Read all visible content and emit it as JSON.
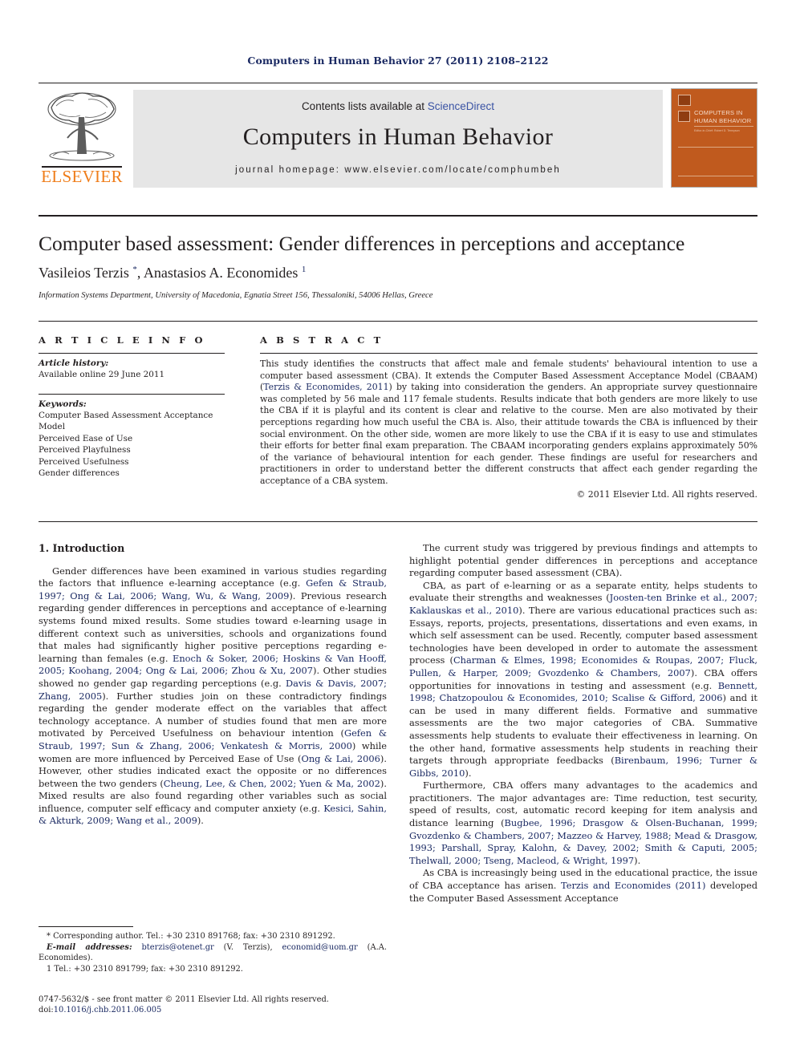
{
  "running_head": "Computers in Human Behavior 27 (2011) 2108–2122",
  "masthead": {
    "contents_prefix": "Contents lists available at ",
    "sciencedirect": "ScienceDirect",
    "journal_title": "Computers in Human Behavior",
    "homepage": "journal homepage: www.elsevier.com/locate/comphumbeh",
    "publisher_wordmark": "ELSEVIER",
    "cover": {
      "title": "COMPUTERS IN HUMAN BEHAVIOR",
      "subtitle": "Editor-in-Chief: Robert D. Tennyson",
      "accent": "#c05a1e"
    }
  },
  "article": {
    "title": "Computer based assessment: Gender differences in perceptions and acceptance",
    "authors_part1": "Vasileios Terzis ",
    "authors_star": "*",
    "authors_part2": ", Anastasios A. Economides ",
    "authors_sup": "1",
    "affiliation": "Information Systems Department, University of Macedonia, Egnatia Street 156, Thessaloniki, 54006 Hellas, Greece"
  },
  "info": {
    "heading": "A R T I C L E   I N F O",
    "history_label": "Article history:",
    "history_value": "Available online 29 June 2011",
    "keywords_label": "Keywords:",
    "keywords": [
      "Computer Based Assessment Acceptance",
      "Model",
      "Perceived Ease of Use",
      "Perceived Playfulness",
      "Perceived Usefulness",
      "Gender differences"
    ]
  },
  "abstract": {
    "heading": "A B S T R A C T",
    "text_before_ref": "This study identifies the constructs that affect male and female students' behavioural intention to use a computer based assessment (CBA). It extends the Computer Based Assessment Acceptance Model (CBAAM) (",
    "ref": "Terzis & Economides, 2011",
    "text_after_ref": ") by taking into consideration the genders. An appropriate survey questionnaire was completed by 56 male and 117 female students. Results indicate that both genders are more likely to use the CBA if it is playful and its content is clear and relative to the course. Men are also motivated by their perceptions regarding how much useful the CBA is. Also, their attitude towards the CBA is influenced by their social environment. On the other side, women are more likely to use the CBA if it is easy to use and stimulates their efforts for better final exam preparation. The CBAAM incorporating genders explains approximately 50% of the variance of behavioural intention for each gender. These findings are useful for researchers and practitioners in order to understand better the different constructs that affect each gender regarding the acceptance of a CBA system.",
    "copyright": "© 2011 Elsevier Ltd. All rights reserved."
  },
  "body": {
    "section_heading": "1. Introduction",
    "left": {
      "p1_a": "Gender differences have been examined in various studies regarding the factors that influence e-learning acceptance (e.g. ",
      "p1_ref1": "Gefen & Straub, 1997; Ong & Lai, 2006; Wang, Wu, & Wang, 2009",
      "p1_b": "). Previous research regarding gender differences in perceptions and acceptance of e-learning systems found mixed results. Some studies toward e-learning usage in different context such as universities, schools and organizations found that males had significantly higher positive perceptions regarding e-learning than females (e.g. ",
      "p1_ref2": "Enoch & Soker, 2006; Hoskins & Van Hooff, 2005; Koohang, 2004; Ong & Lai, 2006; Zhou & Xu, 2007",
      "p1_c": "). Other studies showed no gender gap regarding perceptions (e.g. ",
      "p1_ref3": "Davis & Davis, 2007; Zhang, 2005",
      "p1_d": "). Further studies join on these contradictory findings regarding the gender moderate effect on the variables that affect technology acceptance. A number of studies found that men are more motivated by Perceived Usefulness on behaviour intention (",
      "p1_ref4": "Gefen & Straub, 1997; Sun & Zhang, 2006; Venkatesh & Morris, 2000",
      "p1_e": ") while women are more influenced by Perceived Ease of Use (",
      "p1_ref5": "Ong & Lai, 2006",
      "p1_f": "). However, other studies indicated exact the opposite or no differences between the two genders (",
      "p1_ref6": "Cheung, Lee, & Chen, 2002; Yuen & Ma, 2002",
      "p1_g": "). Mixed results are also found regarding other variables such as social influence, computer self efficacy and computer anxiety (e.g. ",
      "p1_ref7": "Kesici, Sahin, & Akturk, 2009; Wang et al., 2009",
      "p1_h": ")."
    },
    "right": {
      "p1": "The current study was triggered by previous findings and attempts to highlight potential gender differences in perceptions and acceptance regarding computer based assessment (CBA).",
      "p2_a": "CBA, as part of e-learning or as a separate entity, helps students to evaluate their strengths and weaknesses (",
      "p2_ref1": "Joosten-ten Brinke et al., 2007; Kaklauskas et al., 2010",
      "p2_b": "). There are various educational practices such as: Essays, reports, projects, presentations, dissertations and even exams, in which self assessment can be used. Recently, computer based assessment technologies have been developed in order to automate the assessment process (",
      "p2_ref2": "Charman & Elmes, 1998; Economides & Roupas, 2007; Fluck, Pullen, & Harper, 2009; Gvozdenko & Chambers, 2007",
      "p2_c": "). CBA offers opportunities for innovations in testing and assessment (e.g. ",
      "p2_ref3": "Bennett, 1998; Chatzopoulou & Economides, 2010; Scalise & Gifford, 2006",
      "p2_d": ") and it can be used in many different fields. Formative and summative assessments are the two major categories of CBA. Summative assessments help students to evaluate their effectiveness in learning. On the other hand, formative assessments help students in reaching their targets through appropriate feedbacks (",
      "p2_ref4": "Birenbaum, 1996; Turner & Gibbs, 2010",
      "p2_e": ").",
      "p3_a": "Furthermore, CBA offers many advantages to the academics and practitioners. The major advantages are: Time reduction, test security, speed of results, cost, automatic record keeping for item analysis and distance learning (",
      "p3_ref1": "Bugbee, 1996; Drasgow & Olsen-Buchanan, 1999; Gvozdenko & Chambers, 2007; Mazzeo & Harvey, 1988; Mead & Drasgow, 1993; Parshall, Spray, Kalohn, & Davey, 2002; Smith & Caputi, 2005; Thelwall, 2000; Tseng, Macleod, & Wright, 1997",
      "p3_b": ").",
      "p4_a": "As CBA is increasingly being used in the educational practice, the issue of CBA acceptance has arisen. ",
      "p4_ref1": "Terzis and Economides (2011)",
      "p4_b": " developed the Computer Based Assessment Acceptance"
    }
  },
  "footnotes": {
    "corresponding": "* Corresponding author. Tel.: +30 2310 891768; fax: +30 2310 891292.",
    "email_label": "E-mail addresses:",
    "email1": "bterzis@otenet.gr",
    "email1_owner": " (V. Terzis), ",
    "email2": "economid@uom.gr",
    "email2_owner": " (A.A. Economides).",
    "footnote1": "1 Tel.: +30 2310 891799; fax: +30 2310 891292."
  },
  "imprint": {
    "line1": "0747-5632/$ - see front matter © 2011 Elsevier Ltd. All rights reserved.",
    "doi_label": "doi:",
    "doi_value": "10.1016/j.chb.2011.06.005"
  }
}
